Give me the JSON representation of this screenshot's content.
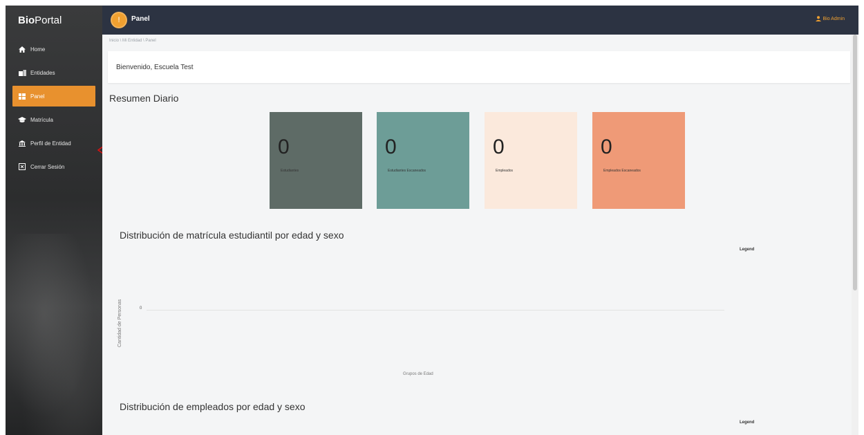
{
  "sidebar": {
    "logo_bold": "Bio",
    "logo_rest": "Portal",
    "items": [
      {
        "label": "Home",
        "icon": "home-icon"
      },
      {
        "label": "Entidades",
        "icon": "building-icon"
      },
      {
        "label": "Panel",
        "icon": "dashboard-icon",
        "active": true
      },
      {
        "label": "Matrícula",
        "icon": "graduation-cap-icon"
      },
      {
        "label": "Perfil de Entidad",
        "icon": "institution-icon"
      },
      {
        "label": "Cerrar Sesión",
        "icon": "logout-icon"
      }
    ]
  },
  "header": {
    "title": "Panel",
    "badge": "!",
    "user": "Bio Admin"
  },
  "breadcrumb": "Inicio \\ Mi Entidad \\ Panel",
  "welcome": "Bienvenido, Escuela Test",
  "summary": {
    "title": "Resumen Diario",
    "cards": [
      {
        "value": "0",
        "label": "Estudiantes",
        "color": "#5e6b66"
      },
      {
        "value": "0",
        "label": "Estudiantes Escaneados",
        "color": "#6d9d97"
      },
      {
        "value": "0",
        "label": "Empleados",
        "color": "#fbe9dc"
      },
      {
        "value": "0",
        "label": "Empleados Escaneados",
        "color": "#ef9a77"
      }
    ]
  },
  "chart1": {
    "title": "Distribución de matrícula estudiantil por edad y sexo",
    "legend": "Legend",
    "ylabel": "Cantidad de Personas",
    "ytick": "0",
    "xlabel": "Grupos de Edad"
  },
  "chart2": {
    "title": "Distribución de empleados por edad y sexo",
    "legend": "Legend"
  },
  "colors": {
    "accent": "#e8912e",
    "topbar": "#2c3342",
    "sidebar": "#2e2f30"
  }
}
